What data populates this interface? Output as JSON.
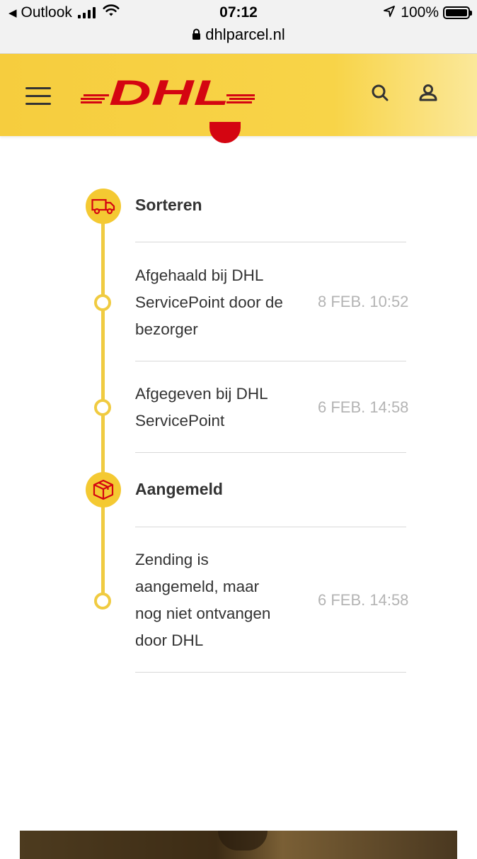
{
  "status_bar": {
    "back_app": "Outlook",
    "time": "07:12",
    "battery": "100%",
    "url": "dhlparcel.nl"
  },
  "header": {
    "logo_text": "DHL",
    "brand_color": "#d40511",
    "accent_color": "#f6cd3e"
  },
  "timeline": {
    "sections": [
      {
        "title": "Sorteren",
        "icon": "truck-icon",
        "events": [
          {
            "text": "Afgehaald bij DHL\nServicePoint door de\nbezorger",
            "date": "8 FEB. 10:52"
          },
          {
            "text": "Afgegeven bij DHL\nServicePoint",
            "date": "6 FEB. 14:58"
          }
        ]
      },
      {
        "title": "Aangemeld",
        "icon": "package-icon",
        "events": [
          {
            "text": "Zending is\naangemeld, maar\nnog niet ontvangen\ndoor DHL",
            "date": "6 FEB. 14:58"
          }
        ]
      }
    ]
  }
}
